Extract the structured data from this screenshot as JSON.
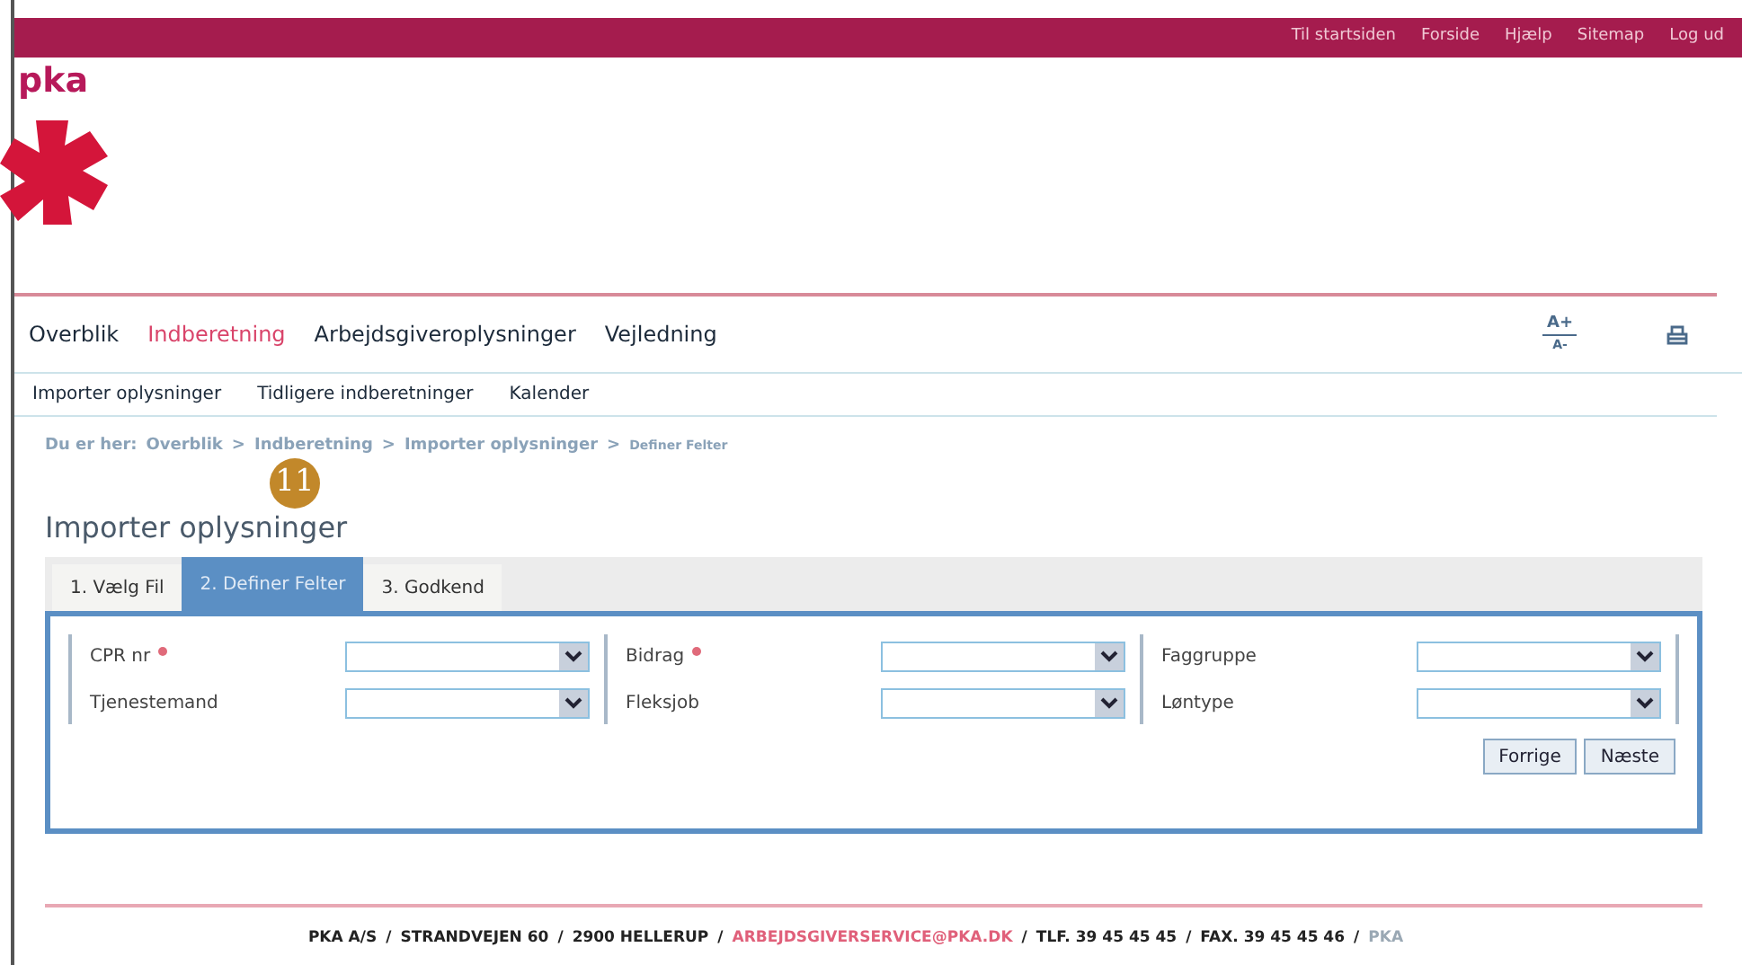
{
  "top_links": [
    "Til startsiden",
    "Forside",
    "Hjælp",
    "Sitemap",
    "Log ud"
  ],
  "logo": {
    "text": "pka"
  },
  "main_nav": [
    {
      "label": "Overblik",
      "selected": false
    },
    {
      "label": "Indberetning",
      "selected": true
    },
    {
      "label": "Arbejdsgiveroplysninger",
      "selected": false
    },
    {
      "label": "Vejledning",
      "selected": false
    }
  ],
  "text_size": {
    "larger": "A+",
    "smaller": "A-"
  },
  "sub_nav": [
    "Importer oplysninger",
    "Tidligere indberetninger",
    "Kalender"
  ],
  "breadcrumb": {
    "prefix": "Du er her:",
    "items": [
      {
        "text": "Overblik"
      },
      {
        "separator": ">",
        "text": "Indberetning"
      },
      {
        "separator": ">",
        "text": "Importer oplysninger"
      },
      {
        "separator": ">",
        "text": "Definer Felter"
      }
    ]
  },
  "callout": "11",
  "page_title": "Importer oplysninger",
  "steps": [
    {
      "label": "1. Vælg Fil",
      "selected": false
    },
    {
      "label": "2. Definer Felter",
      "selected": true
    },
    {
      "label": "3. Godkend",
      "selected": false
    }
  ],
  "field_columns": [
    [
      {
        "label": "CPR nr",
        "required": true
      },
      {
        "label": "Tjenestemand",
        "required": false
      }
    ],
    [
      {
        "label": "Bidrag",
        "required": true
      },
      {
        "label": "Fleksjob",
        "required": false
      }
    ],
    [
      {
        "label": "Faggruppe",
        "required": false
      },
      {
        "label": "Løntype",
        "required": false
      }
    ]
  ],
  "buttons": [
    "Forrige",
    "Næste"
  ],
  "footer": [
    {
      "text": "PKA A/S",
      "kind": "plain"
    },
    {
      "separator": "/",
      "text": "STRANDVEJEN 60",
      "kind": "plain"
    },
    {
      "separator": "/",
      "text": "2900 HELLERUP",
      "kind": "plain"
    },
    {
      "separator": "/",
      "text": "ARBEJDSGIVERSERVICE@PKA.DK",
      "kind": "link"
    },
    {
      "separator": "/",
      "text": "TLF. 39 45 45 45",
      "kind": "plain"
    },
    {
      "separator": "/",
      "text": "FAX. 39 45 45 46",
      "kind": "plain"
    },
    {
      "separator": "/",
      "text": "PKA",
      "kind": "muted"
    }
  ]
}
